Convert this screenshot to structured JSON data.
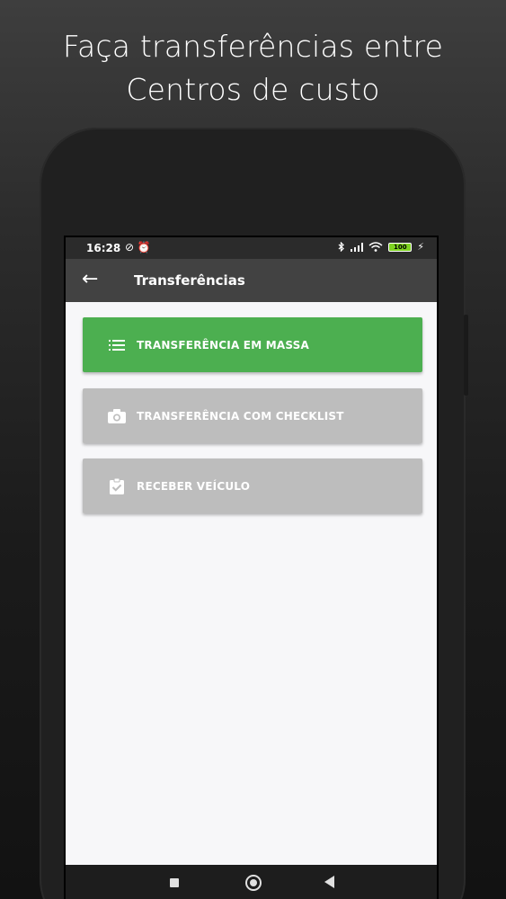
{
  "headline": {
    "line1": "Faça transferências entre",
    "line2": "Centros de custo"
  },
  "status_bar": {
    "time": "16:28",
    "battery": "100"
  },
  "app_bar": {
    "title": "Transferências"
  },
  "actions": [
    {
      "label": "TRANSFERÊNCIA EM MASSA",
      "icon": "list-icon",
      "color": "#4caf50"
    },
    {
      "label": "TRANSFERÊNCIA COM CHECKLIST",
      "icon": "camera-icon",
      "color": "#bdbdbd"
    },
    {
      "label": "RECEBER VEÍCULO",
      "icon": "clipboard-check-icon",
      "color": "#bdbdbd"
    }
  ],
  "colors": {
    "primary_green": "#4caf50",
    "app_bar": "#424242",
    "disabled_button": "#bdbdbd",
    "content_bg": "#f7f7f9"
  }
}
